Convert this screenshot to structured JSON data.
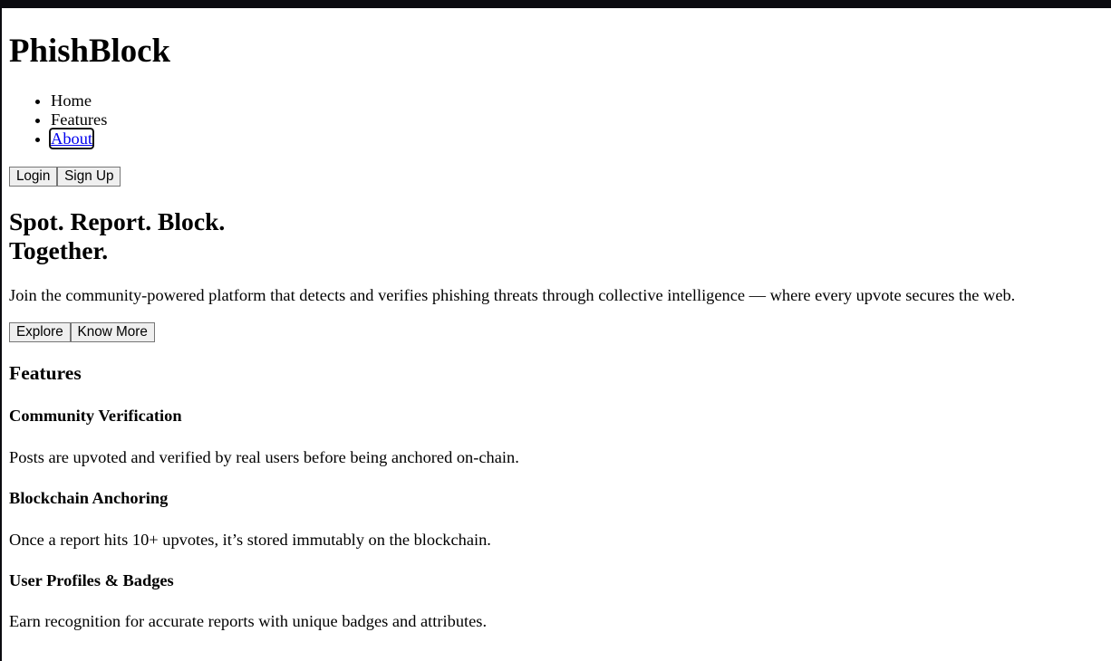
{
  "header": {
    "brand": "PhishBlock",
    "nav": [
      {
        "label": "Home"
      },
      {
        "label": "Features"
      },
      {
        "label": "About"
      }
    ],
    "login": "Login",
    "signup": "Sign Up"
  },
  "hero": {
    "title_line1": "Spot. Report. Block.",
    "title_line2": "Together.",
    "description": "Join the community-powered platform that detects and verifies phishing threats through collective intelligence — where every upvote secures the web.",
    "explore": "Explore",
    "know_more": "Know More"
  },
  "features": {
    "heading": "Features",
    "items": [
      {
        "title": "Community Verification",
        "text": "Posts are upvoted and verified by real users before being anchored on-chain."
      },
      {
        "title": "Blockchain Anchoring",
        "text": "Once a report hits 10+ upvotes, it’s stored immutably on the blockchain."
      },
      {
        "title": "User Profiles & Badges",
        "text": "Earn recognition for accurate reports with unique badges and attributes."
      }
    ]
  }
}
